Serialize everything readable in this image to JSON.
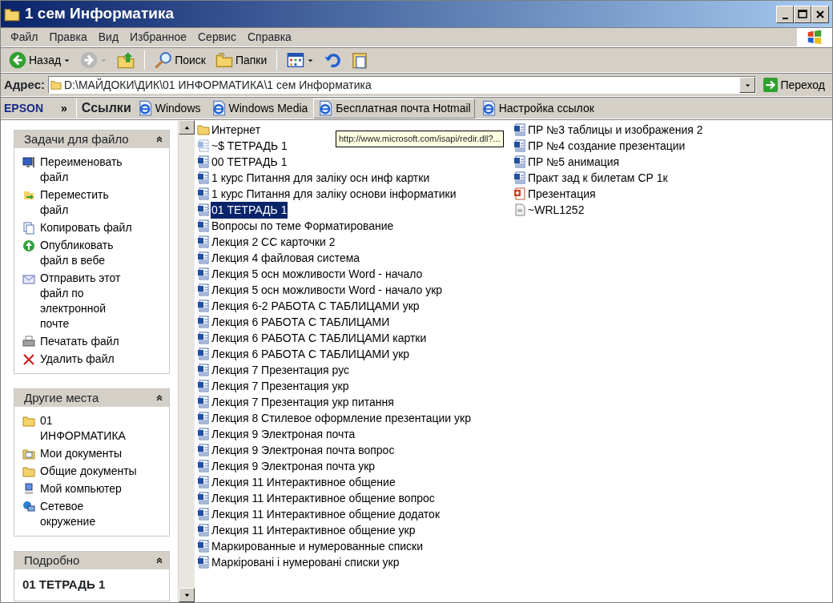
{
  "window": {
    "title": "1 сем Информатика"
  },
  "menu": [
    "Файл",
    "Правка",
    "Вид",
    "Избранное",
    "Сервис",
    "Справка"
  ],
  "toolbar": [
    {
      "kind": "back",
      "label": "Назад"
    },
    {
      "kind": "forward"
    },
    {
      "kind": "up"
    },
    {
      "kind": "search",
      "label": "Поиск"
    },
    {
      "kind": "folders",
      "label": "Папки"
    },
    {
      "kind": "views"
    },
    {
      "kind": "undo"
    },
    {
      "kind": "paste"
    }
  ],
  "address": {
    "label": "Адрес:",
    "value": "D:\\МАЙДОКИ\\ДИК\\01 ИНФОРМАТИКА\\1 сем Информатика",
    "go": "Переход"
  },
  "links_bar": {
    "epson": "EPSON",
    "chevron": "»",
    "title": "Ссылки",
    "items": [
      {
        "label": "Windows",
        "selected": false
      },
      {
        "label": "Windows Media",
        "selected": false
      },
      {
        "label": "Бесплатная почта Hotmail",
        "selected": true
      },
      {
        "label": "Настройка ссылок",
        "selected": false
      }
    ]
  },
  "panels": [
    {
      "title": "Задачи для файло",
      "items": [
        {
          "kind": "rename",
          "label": "Переименовать файл"
        },
        {
          "kind": "move",
          "label": "Переместить файл"
        },
        {
          "kind": "copy",
          "label": "Копировать файл"
        },
        {
          "kind": "publish",
          "label": "Опубликовать файл в вебе"
        },
        {
          "kind": "mail",
          "label": "Отправить этот файл по электронной почте"
        },
        {
          "kind": "print",
          "label": "Печатать файл"
        },
        {
          "kind": "delete",
          "label": "Удалить файл"
        }
      ]
    },
    {
      "title": "Другие места",
      "items": [
        {
          "kind": "folder",
          "label": "01 ИНФОРМАТИКА"
        },
        {
          "kind": "docs",
          "label": "Мои документы"
        },
        {
          "kind": "folder",
          "label": "Общие документы"
        },
        {
          "kind": "computer",
          "label": "Мой компьютер"
        },
        {
          "kind": "network",
          "label": "Сетевое окружение"
        }
      ]
    },
    {
      "title": "Подробно",
      "detail_name": "01 ТЕТРАДЬ 1"
    }
  ],
  "files": [
    {
      "kind": "folder",
      "name": "Интернет",
      "selected": false
    },
    {
      "kind": "temp",
      "name": "~$ ТЕТРАДЬ 1",
      "selected": false
    },
    {
      "kind": "word",
      "name": "00 ТЕТРАДЬ 1",
      "selected": false
    },
    {
      "kind": "word",
      "name": "1 курс Питання для заліку осн инф картки",
      "selected": false
    },
    {
      "kind": "word",
      "name": "1 курс Питання для заліку основи інформатики",
      "selected": false
    },
    {
      "kind": "word",
      "name": "01 ТЕТРАДЬ 1",
      "selected": true
    },
    {
      "kind": "word",
      "name": "Вопросы по теме Форматирование",
      "selected": false
    },
    {
      "kind": "word",
      "name": "Лекция 2 СС карточки 2",
      "selected": false
    },
    {
      "kind": "word",
      "name": "Лекция 4 файловая система",
      "selected": false
    },
    {
      "kind": "word",
      "name": "Лекция 5 осн можливости Word - начало",
      "selected": false
    },
    {
      "kind": "word",
      "name": "Лекция 5 осн можливости Word - начало укр",
      "selected": false
    },
    {
      "kind": "word",
      "name": "Лекция 6-2 РАБОТА С ТАБЛИЦАМИ укр",
      "selected": false
    },
    {
      "kind": "word",
      "name": "Лекция 6 РАБОТА С ТАБЛИЦАМИ",
      "selected": false
    },
    {
      "kind": "word",
      "name": "Лекция 6 РАБОТА С ТАБЛИЦАМИ картки",
      "selected": false
    },
    {
      "kind": "word",
      "name": "Лекция 6 РАБОТА С ТАБЛИЦАМИ укр",
      "selected": false
    },
    {
      "kind": "word",
      "name": "Лекция 7 Презентация рус",
      "selected": false
    },
    {
      "kind": "word",
      "name": "Лекция 7 Презентация укр",
      "selected": false
    },
    {
      "kind": "word",
      "name": "Лекция 7 Презентация укр питання",
      "selected": false
    },
    {
      "kind": "word",
      "name": "Лекция 8 Стилевое оформление презентации укр",
      "selected": false
    },
    {
      "kind": "word",
      "name": "Лекция 9 Электроная почта",
      "selected": false
    },
    {
      "kind": "word",
      "name": "Лекция 9 Электроная почта вопрос",
      "selected": false
    },
    {
      "kind": "word",
      "name": "Лекция 9 Электроная почта укр",
      "selected": false
    },
    {
      "kind": "word",
      "name": "Лекция 11 Интерактивное общение",
      "selected": false
    },
    {
      "kind": "word",
      "name": "Лекция 11 Интерактивное общение вопрос",
      "selected": false
    },
    {
      "kind": "word",
      "name": "Лекция 11 Интерактивное общение додаток",
      "selected": false
    },
    {
      "kind": "word",
      "name": "Лекция 11 Интерактивное общение укр",
      "selected": false
    },
    {
      "kind": "word",
      "name": "Маркированные и нумерованные списки",
      "selected": false
    },
    {
      "kind": "word",
      "name": "Маркіровані і нумеровані списки укр",
      "selected": false
    },
    {
      "kind": "word",
      "name": "ПР №3 таблицы и изображения 2",
      "selected": false
    },
    {
      "kind": "word",
      "name": "ПР №4 создание презентации",
      "selected": false
    },
    {
      "kind": "word",
      "name": "ПР №5 анимация",
      "selected": false
    },
    {
      "kind": "word",
      "name": "Практ зад к билетам СР 1к",
      "selected": false
    },
    {
      "kind": "ppt",
      "name": "Презентация",
      "selected": false
    },
    {
      "kind": "wrl",
      "name": "~WRL1252",
      "selected": false
    }
  ],
  "tooltip": "http://www.microsoft.com/isapi/redir.dll?..."
}
